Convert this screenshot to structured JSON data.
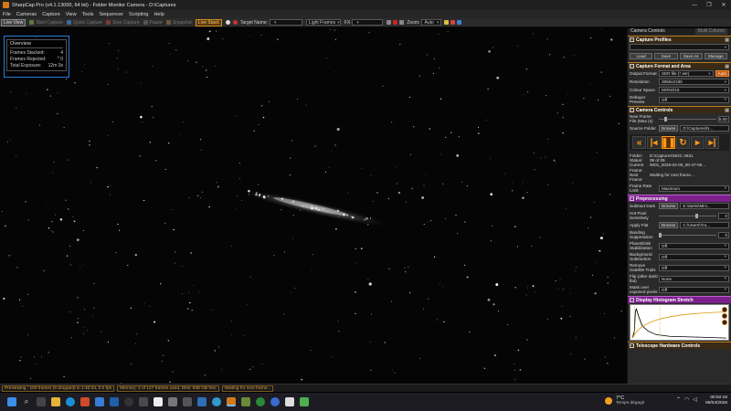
{
  "titlebar": {
    "title": "SharpCap Pro (v4.1.13000, 64 bit) - Folder Monitor Camera - D:\\Captures",
    "minimize": "—",
    "maximize": "❐",
    "close": "✕"
  },
  "menu": [
    "File",
    "Cameras",
    "Capture",
    "View",
    "Tools",
    "Sequencer",
    "Scripting",
    "Help"
  ],
  "toolbar": {
    "live_view": "Live View",
    "start_capture": "Start Capture",
    "quick_capture": "Quick Capture",
    "stop_capture": "Stop Capture",
    "pause": "Pause",
    "snapshot": "Snapshot",
    "live_stack": "Live Stack",
    "target_name_label": "Target Name:",
    "target_name_value": "",
    "frame_type": "Light Frames",
    "fx_label": "FX",
    "fx_value": "",
    "zoom_label": "Zoom:",
    "zoom_value": "Auto"
  },
  "overview": {
    "title": "Overview",
    "rows": [
      {
        "label": "Frames Stacked:",
        "value": "4"
      },
      {
        "label": "Frames Rejected:",
        "value": "0"
      },
      {
        "label": "Total Exposure:",
        "value": "12m 0s"
      }
    ]
  },
  "panel": {
    "tab_active": "Camera Controls",
    "tab_inactive": "Multi Column",
    "capture_profiles": {
      "title": "Capture Profiles",
      "buttons": [
        "Load",
        "Save",
        "Save As",
        "Manage"
      ]
    },
    "capture_format": {
      "title": "Capture Format and Area",
      "output_format_label": "Output Format",
      "output_format_value": "SER file (*.ser)",
      "output_format_button": "Auto",
      "resolution_label": "Resolution",
      "resolution_value": "3856x2180",
      "colour_space_label": "Colour Space",
      "colour_space_value": "MONO16",
      "debayer_label": "Debayer Preview",
      "debayer_value": "Off"
    },
    "camera_controls": {
      "title": "Camera Controls",
      "new_frame_label": "New Frame File (Max (s)",
      "new_frame_value": "5.00",
      "source_folder_label": "Source Folder",
      "source_folder_button": "Browse",
      "source_folder_value": "D:\\Captures\\N...",
      "folder_label": "Folder:",
      "folder_value": "D:\\Captures\\NGC 4631",
      "status_label": "Status:",
      "status_value": "08 of 09",
      "current_frame_label": "Current Frame:",
      "current_frame_value": "0001_2026-04-06_00-47-05...",
      "next_frame_label": "Next Frame:",
      "next_frame_value": "Waiting for next frame...",
      "frame_rate_label": "Frame Rate Limit",
      "frame_rate_value": "Maximum"
    },
    "preprocessing": {
      "title": "Preprocessing",
      "subtract_dark_label": "Subtract Dark",
      "subtract_dark_button": "Browse",
      "subtract_dark_value": "E:\\darks\\Mini...",
      "hot_pixel_label": "Hot Pixel Sensitivity",
      "hot_pixel_value": "0",
      "apply_flat_label": "Apply Flat",
      "apply_flat_button": "Browse",
      "apply_flat_value": "C:\\Users\\Tra...",
      "banding_label": "Banding Suppression",
      "banding_value": "0",
      "planet_label": "Planet/Disk Stabilization",
      "planet_value": "Off",
      "background_label": "Background Subtraction",
      "background_value": "Off",
      "satellite_label": "Remove Satellite Trails",
      "satellite_value": "Off",
      "flip_label": "Flip (after dark/ flat)",
      "flip_value": "None",
      "mask_label": "Mask over exposed pixels",
      "mask_value": "Off"
    },
    "histogram": {
      "title": "Display Histogram Stretch"
    },
    "telescope": {
      "title": "Telescope Hardware Controls"
    }
  },
  "status": {
    "previewing": "Previewing : 103 frames (0 dropped) in 1:40:34, 0.0 fps",
    "memory": "Memory: 4 of 127 frames used, Disk: 838 GB free",
    "waiting": "Waiting for next frame..."
  },
  "weather": {
    "temp": "7°C",
    "desc": "Temps dégagé"
  },
  "clock": {
    "time": "00:52:16",
    "date": "06/04/2026"
  }
}
